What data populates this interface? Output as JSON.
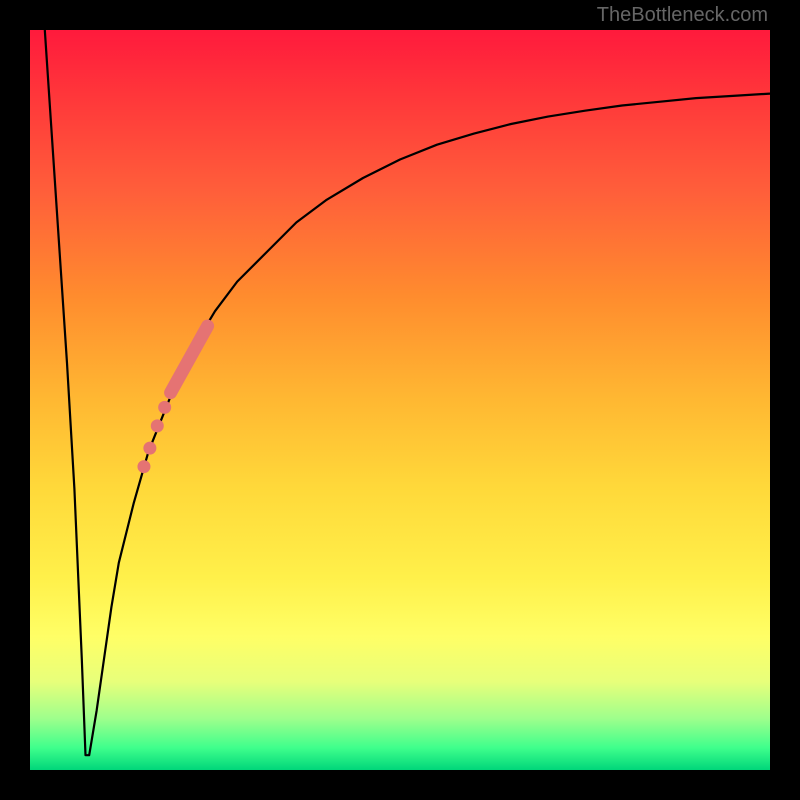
{
  "watermark": "TheBottleneck.com",
  "colors": {
    "frame": "#000000",
    "curve": "#000000",
    "marker": "#e57373",
    "gradient_top": "#ff1a3c",
    "gradient_bottom": "#00d67a"
  },
  "chart_data": {
    "type": "line",
    "title": "",
    "xlabel": "",
    "ylabel": "",
    "xlim": [
      0,
      100
    ],
    "ylim": [
      0,
      100
    ],
    "grid": false,
    "legend": false,
    "series": [
      {
        "name": "bottleneck-curve",
        "comment": "V-shaped bottleneck curve; y is bottleneck percentage, x is relative component performance. Values estimated from pixel positions.",
        "x": [
          2,
          3,
          4,
          5,
          6,
          7,
          7.5,
          8,
          9,
          10,
          11,
          12,
          14,
          16,
          18,
          20,
          22,
          25,
          28,
          32,
          36,
          40,
          45,
          50,
          55,
          60,
          65,
          70,
          75,
          80,
          85,
          90,
          95,
          100
        ],
        "y": [
          100,
          85,
          70,
          55,
          38,
          15,
          2,
          2,
          8,
          15,
          22,
          28,
          36,
          43,
          48,
          53,
          57,
          62,
          66,
          70,
          74,
          77,
          80,
          82.5,
          84.5,
          86,
          87.3,
          88.3,
          89.1,
          89.8,
          90.3,
          90.8,
          91.1,
          91.4
        ]
      }
    ],
    "markers": [
      {
        "name": "highlight-segment",
        "shape": "thick-line",
        "x_range": [
          19,
          24
        ],
        "y_range": [
          51,
          60
        ]
      },
      {
        "name": "dot-1",
        "shape": "circle",
        "x": 18.2,
        "y": 49
      },
      {
        "name": "dot-2",
        "shape": "circle",
        "x": 17.2,
        "y": 46.5
      },
      {
        "name": "dot-3",
        "shape": "circle",
        "x": 16.2,
        "y": 43.5
      },
      {
        "name": "dot-4",
        "shape": "circle",
        "x": 15.4,
        "y": 41
      }
    ]
  }
}
